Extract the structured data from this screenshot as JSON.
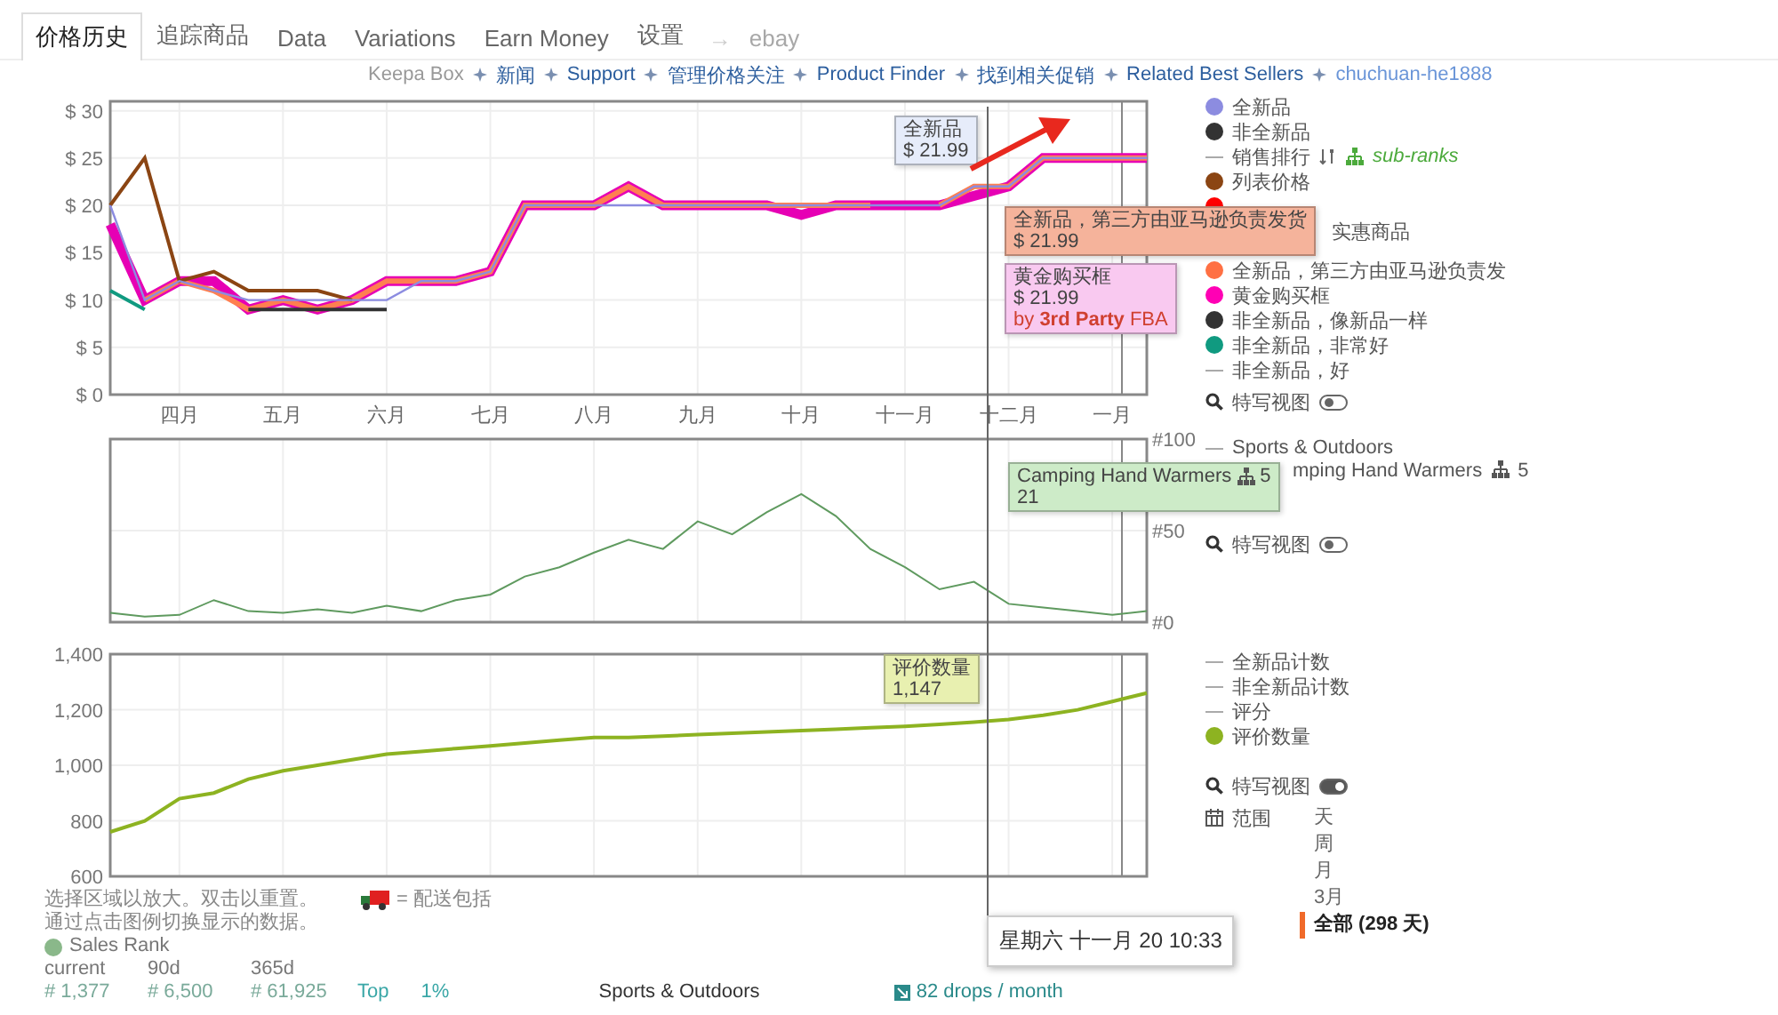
{
  "tabs": [
    {
      "label": "价格历史",
      "selected": true
    },
    {
      "label": "追踪商品",
      "selected": false
    },
    {
      "label": "Data",
      "selected": false
    },
    {
      "label": "Variations",
      "selected": false
    },
    {
      "label": "Earn Money",
      "selected": false
    },
    {
      "label": "设置",
      "selected": false
    }
  ],
  "tab_arrow": "→",
  "ebay_label": "ebay",
  "links": [
    {
      "label": "Keepa Box",
      "kind": "muted"
    },
    {
      "label": "新闻",
      "kind": "link"
    },
    {
      "label": "Support",
      "kind": "link"
    },
    {
      "label": "管理价格关注",
      "kind": "link"
    },
    {
      "label": "Product Finder",
      "kind": "link"
    },
    {
      "label": "找到相关促销",
      "kind": "link"
    },
    {
      "label": "Related Best Sellers",
      "kind": "link"
    },
    {
      "label": "chuchuan-he1888",
      "kind": "user"
    }
  ],
  "price_chart": {
    "chart_data": {
      "type": "line",
      "grid": true,
      "categories": [
        null,
        null,
        "四月",
        null,
        null,
        "五月",
        null,
        null,
        "六月",
        null,
        null,
        "七月",
        null,
        null,
        "八月",
        null,
        null,
        "九月",
        null,
        null,
        "十月",
        null,
        null,
        "十一月",
        null,
        null,
        "十二月",
        null,
        null,
        "一月",
        null
      ],
      "ylim": [
        0,
        31
      ],
      "yticks": [
        {
          "value": 0,
          "label": "$ 0"
        },
        {
          "value": 5,
          "label": "$ 5"
        },
        {
          "value": 10,
          "label": "$ 10"
        },
        {
          "value": 15,
          "label": "$ 15"
        },
        {
          "value": 20,
          "label": "$ 20"
        },
        {
          "value": 25,
          "label": "$ 25"
        },
        {
          "value": 30,
          "label": "$ 30"
        }
      ],
      "series": [
        {
          "color": "#8b4513",
          "values": [
            20,
            25,
            12,
            13,
            11,
            11,
            11,
            10,
            null,
            null,
            null,
            null,
            null,
            null,
            null,
            null,
            null,
            null,
            null,
            null,
            null,
            null,
            null,
            null,
            null,
            null,
            null,
            null,
            null,
            null,
            null
          ]
        },
        {
          "color": "#8c8ce0",
          "values": [
            20,
            10,
            12,
            11,
            10,
            10,
            10,
            10,
            10,
            12,
            12,
            13,
            20,
            20,
            20,
            20,
            20,
            20,
            20,
            20,
            20,
            20,
            20,
            20,
            20,
            22,
            22,
            25,
            25,
            25,
            25
          ]
        },
        {
          "color": "#ff7f50",
          "values": [
            null,
            10,
            12,
            11,
            9,
            10,
            9,
            10,
            12,
            12,
            12,
            13,
            20,
            20,
            20,
            22,
            20,
            20,
            20,
            20,
            20,
            20,
            20,
            null,
            20,
            22,
            22,
            25,
            25,
            25,
            25
          ]
        },
        {
          "color": "#e600b4",
          "values": [
            18,
            10,
            12,
            12,
            9,
            10,
            9,
            10,
            12,
            12,
            12,
            13,
            20,
            20,
            20,
            22,
            20,
            20,
            20,
            20,
            19,
            20,
            20,
            20,
            20,
            21,
            22,
            25,
            25,
            25,
            25
          ]
        },
        {
          "color": "#333333",
          "values": [
            null,
            null,
            null,
            null,
            9,
            9,
            9,
            9,
            9,
            null,
            null,
            null,
            null,
            null,
            null,
            null,
            null,
            null,
            null,
            null,
            null,
            null,
            null,
            null,
            null,
            null,
            null,
            null,
            null,
            null,
            null
          ]
        },
        {
          "color": "#109a80",
          "values": [
            11,
            9,
            null,
            null,
            null,
            null,
            null,
            null,
            null,
            null,
            null,
            null,
            null,
            null,
            null,
            null,
            null,
            null,
            null,
            null,
            null,
            null,
            null,
            null,
            null,
            null,
            null,
            null,
            null,
            null,
            null
          ]
        }
      ]
    },
    "tooltips": [
      {
        "title": "全新品",
        "value": "$ 21.99",
        "color": "#e6ecfa"
      },
      {
        "title": "全新品，第三方由亚马逊负责发货",
        "value": "$ 21.99",
        "color": "#f5b39b"
      },
      {
        "title": "黄金购买框",
        "value": "$ 21.99",
        "note": "by **3rd Party** FBA",
        "color": "#f9c9f0"
      }
    ]
  },
  "price_legend": {
    "items": [
      {
        "kind": "dot",
        "label": "全新品",
        "color": "#8c8ce0"
      },
      {
        "kind": "dot",
        "label": "非全新品",
        "color": "#333333"
      },
      {
        "kind": "line",
        "label": "销售排行",
        "sub_label": "sub-ranks"
      },
      {
        "kind": "dot",
        "label": "列表价格",
        "color": "#8b4513"
      },
      {
        "kind": "dot",
        "color": "#ff0000"
      },
      {
        "kind": "covered",
        "label": "实惠商品"
      },
      {
        "kind": "dot",
        "label": "全新品，第三方由亚马逊负责发",
        "color": "#ff7043"
      },
      {
        "kind": "dot",
        "label": "黄金购买框",
        "color": "#ff00b4"
      },
      {
        "kind": "dot",
        "label": "非全新品，像新品一样",
        "color": "#333333"
      },
      {
        "kind": "dot",
        "label": "非全新品，非常好",
        "color": "#109a80"
      },
      {
        "kind": "line",
        "label": "非全新品，好"
      }
    ],
    "closeup": {
      "label": "特写视图",
      "on": false
    }
  },
  "rank_chart": {
    "chart_data": {
      "type": "line",
      "grid": true,
      "categories": [
        null,
        null,
        null,
        null,
        null,
        null,
        null,
        null,
        null,
        null,
        null,
        null,
        null,
        null,
        null,
        null,
        null,
        null,
        null,
        null,
        null,
        null,
        null,
        null,
        null,
        null,
        null,
        null,
        null,
        null,
        null
      ],
      "ylim": [
        0,
        100
      ],
      "yticks": [
        {
          "value": 0,
          "label": "#0"
        },
        {
          "value": 50,
          "label": "#50"
        },
        {
          "value": 100,
          "label": "#100"
        }
      ],
      "series": [
        {
          "color": "#5f9a5f",
          "values": [
            5,
            3,
            4,
            12,
            6,
            5,
            7,
            5,
            9,
            6,
            12,
            15,
            25,
            30,
            38,
            45,
            40,
            55,
            48,
            60,
            70,
            58,
            40,
            30,
            18,
            22,
            10,
            8,
            6,
            4,
            6
          ]
        }
      ]
    },
    "tooltips": [
      {
        "title": "Camping Hand Warmers",
        "count": "5",
        "value": "21",
        "color": "#cdebc8"
      }
    ]
  },
  "rank_legend": {
    "items": [
      {
        "kind": "line",
        "label": "Sports & Outdoors"
      },
      {
        "kind": "covered",
        "label": "mping Hand Warmers",
        "count": "5"
      }
    ],
    "closeup": {
      "label": "特写视图",
      "on": false
    }
  },
  "review_chart": {
    "chart_data": {
      "type": "line",
      "grid": true,
      "categories": [
        null,
        null,
        null,
        null,
        null,
        null,
        null,
        null,
        null,
        null,
        null,
        null,
        null,
        null,
        null,
        null,
        null,
        null,
        null,
        null,
        null,
        null,
        null,
        null,
        null,
        null,
        null,
        null,
        null,
        null,
        null
      ],
      "ylim": [
        600,
        1400
      ],
      "yticks": [
        {
          "value": 600,
          "label": "600"
        },
        {
          "value": 800,
          "label": "800"
        },
        {
          "value": 1000,
          "label": "1,000"
        },
        {
          "value": 1200,
          "label": "1,200"
        },
        {
          "value": 1400,
          "label": "1,400"
        }
      ],
      "series": [
        {
          "color": "#8db321",
          "values": [
            760,
            800,
            880,
            900,
            950,
            980,
            1000,
            1020,
            1040,
            1050,
            1060,
            1070,
            1080,
            1090,
            1100,
            1100,
            1105,
            1110,
            1115,
            1120,
            1125,
            1130,
            1135,
            1140,
            1147,
            1155,
            1165,
            1180,
            1200,
            1230,
            1260
          ]
        }
      ]
    },
    "tooltips": [
      {
        "title": "评价数量",
        "value": "1,147",
        "color": "#e8f0b0"
      }
    ]
  },
  "review_legend": {
    "items": [
      {
        "kind": "line",
        "label": "全新品计数"
      },
      {
        "kind": "line",
        "label": "非全新品计数"
      },
      {
        "kind": "line",
        "label": "评分"
      },
      {
        "kind": "dot",
        "label": "评价数量",
        "color": "#8db321"
      }
    ],
    "closeup": {
      "label": "特写视图",
      "on": true
    },
    "range": {
      "label": "范围",
      "options": [
        {
          "label": "天",
          "selected": false
        },
        {
          "label": "周",
          "selected": false
        },
        {
          "label": "月",
          "selected": false
        },
        {
          "label": "3月",
          "selected": false
        },
        {
          "label": "全部 (298 天)",
          "selected": true
        }
      ]
    }
  },
  "crosshair_time": "星期六 十一月 20 10:33",
  "hints": [
    "选择区域以放大。双击以重置。",
    "通过点击图例切换显示的数据。"
  ],
  "shipping_note": "= 配送包括",
  "sales_rank": {
    "title": "Sales Rank",
    "headers": [
      "current",
      "90d",
      "365d"
    ],
    "values": [
      "# 1,377",
      "# 6,500",
      "# 61,925"
    ],
    "top_label": "Top",
    "top_value": "1%",
    "category": "Sports & Outdoors",
    "drops": "82 drops / month"
  }
}
